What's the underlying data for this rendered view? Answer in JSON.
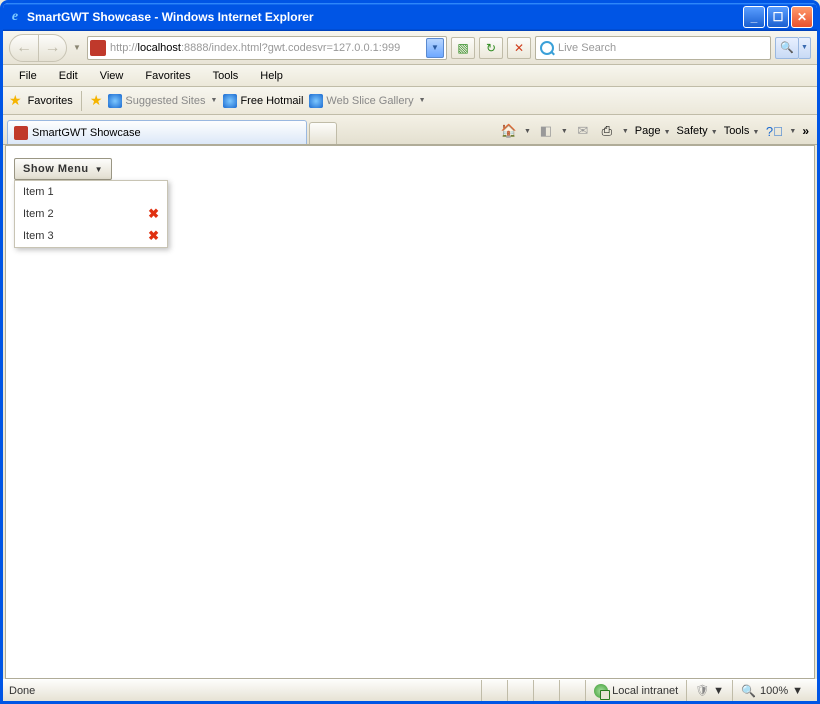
{
  "window_title": "SmartGWT Showcase - Windows Internet Explorer",
  "address": {
    "grey_prefix": "http://",
    "host": "localhost",
    "grey_suffix": ":8888/index.html?gwt.codesvr=127.0.0.1:999"
  },
  "search_placeholder": "Live Search",
  "menubar": [
    "File",
    "Edit",
    "View",
    "Favorites",
    "Tools",
    "Help"
  ],
  "favbar": {
    "favorites": "Favorites",
    "suggested": "Suggested Sites",
    "hotmail": "Free Hotmail",
    "webslice": "Web Slice Gallery"
  },
  "tab_title": "SmartGWT Showcase",
  "cmdbar": {
    "page": "Page",
    "safety": "Safety",
    "tools": "Tools"
  },
  "button_label": "Show Menu",
  "menu_items": [
    {
      "label": "Item 1",
      "removable": false
    },
    {
      "label": "Item 2",
      "removable": true
    },
    {
      "label": "Item 3",
      "removable": true
    }
  ],
  "status": {
    "left": "Done",
    "zone": "Local intranet",
    "zoom": "100%"
  }
}
